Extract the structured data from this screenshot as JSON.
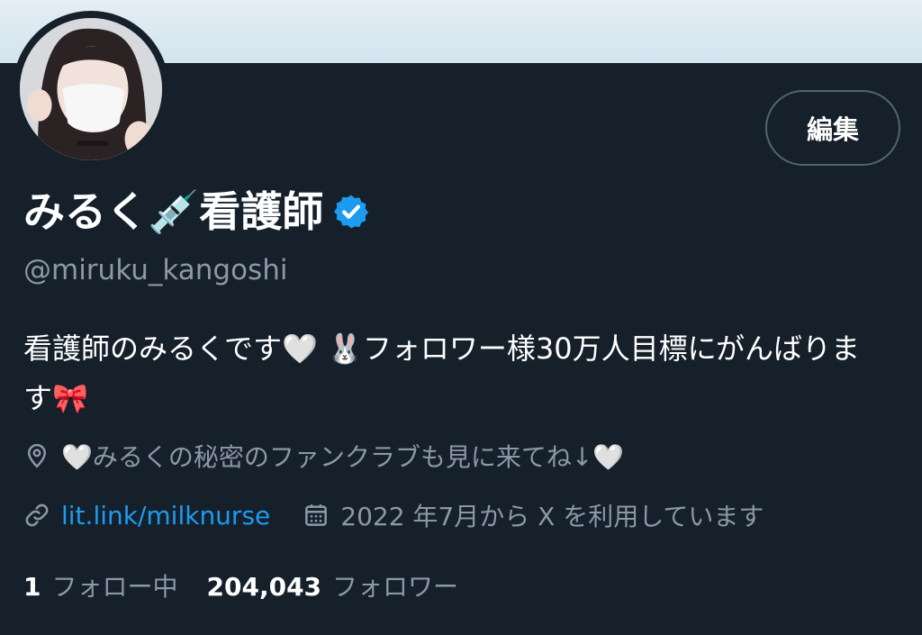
{
  "profile": {
    "display_name": "みるく💉看護師",
    "handle": "@miruku_kangoshi",
    "bio": "看護師のみるくです🤍 🐰フォロワー様30万人目標にがんばります🎀",
    "location": "🤍みるくの秘密のファンクラブも見に来てね↓🤍",
    "website": "lit.link/milknurse",
    "joined": "2022 年7月から X を利用しています"
  },
  "actions": {
    "edit_label": "編集"
  },
  "stats": {
    "following_count": "1",
    "following_label": "フォロー中",
    "followers_count": "204,043",
    "followers_label": "フォロワー"
  },
  "icons": {
    "verified": "verified-badge-icon",
    "location": "location-pin-icon",
    "link": "link-icon",
    "calendar": "calendar-icon"
  },
  "colors": {
    "background": "#15202b",
    "accent": "#1d9bf0",
    "muted_text": "#8b98a5",
    "border": "#536471",
    "banner": "#dde9f0"
  }
}
